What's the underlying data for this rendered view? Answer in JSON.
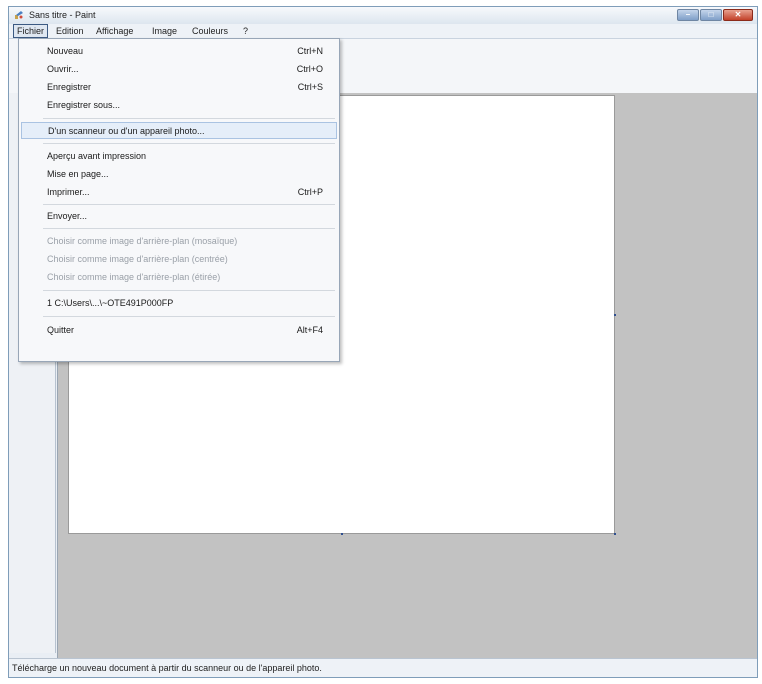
{
  "window": {
    "title": "Sans titre - Paint",
    "icon": "paint-app-icon"
  },
  "menubar": {
    "items": [
      "Fichier",
      "Edition",
      "Affichage",
      "Image",
      "Couleurs",
      "?"
    ]
  },
  "file_menu": {
    "items": [
      {
        "label": "Nouveau",
        "shortcut": "Ctrl+N"
      },
      {
        "label": "Ouvrir...",
        "shortcut": "Ctrl+O"
      },
      {
        "label": "Enregistrer",
        "shortcut": "Ctrl+S"
      },
      {
        "label": "Enregistrer sous...",
        "shortcut": ""
      },
      {
        "label": "D'un scanneur ou d'un appareil photo...",
        "shortcut": ""
      },
      {
        "label": "Aperçu avant impression",
        "shortcut": ""
      },
      {
        "label": "Mise en page...",
        "shortcut": ""
      },
      {
        "label": "Imprimer...",
        "shortcut": "Ctrl+P"
      },
      {
        "label": "Envoyer...",
        "shortcut": ""
      },
      {
        "label": "Choisir comme image d'arrière-plan (mosaïque)",
        "shortcut": ""
      },
      {
        "label": "Choisir comme image d'arrière-plan (centrée)",
        "shortcut": ""
      },
      {
        "label": "Choisir comme image d'arrière-plan (étirée)",
        "shortcut": ""
      },
      {
        "label": "1 C:\\Users\\...\\~OTE491P000FP",
        "shortcut": ""
      },
      {
        "label": "Quitter",
        "shortcut": "Alt+F4"
      }
    ]
  },
  "statusbar": {
    "text": "Télécharge un nouveau document à partir du scanneur ou de l'appareil photo."
  },
  "colors": {
    "workspace": "#c2c2c2",
    "canvas": "#ffffff",
    "highlight": "#e5eef9"
  }
}
